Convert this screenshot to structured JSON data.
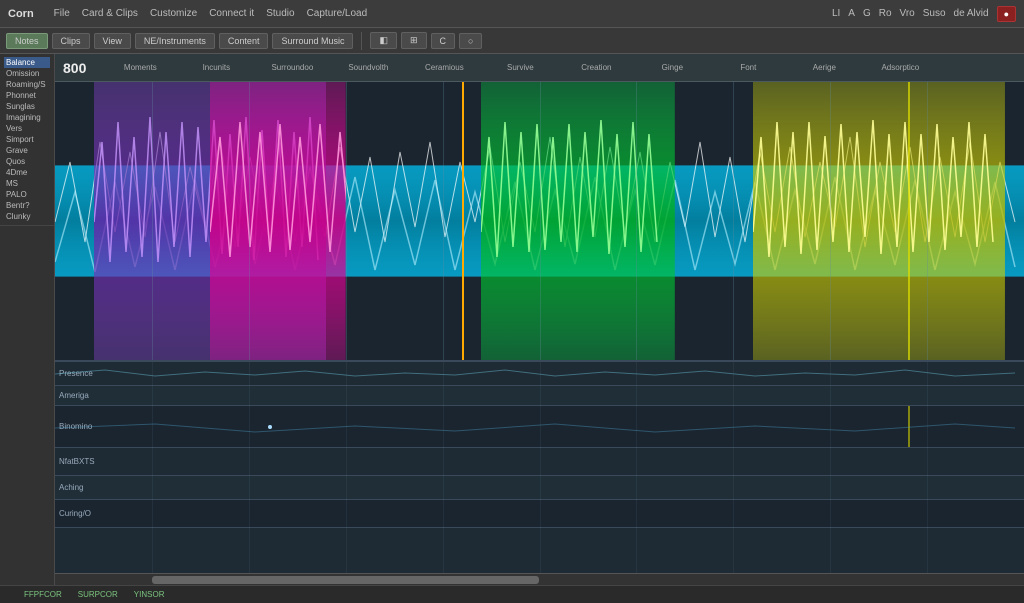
{
  "app": {
    "title": "Corn",
    "menu": [
      "File",
      "Card & Clips",
      "Customize",
      "Connect it",
      "Studio",
      "Capture/Load"
    ]
  },
  "right_controls": {
    "items": [
      "LI",
      "A",
      "G",
      "Ro",
      "Vro",
      "Suso",
      "de Alvid"
    ],
    "rec_label": "●"
  },
  "toolbar": {
    "buttons": [
      "Notes",
      "Clips",
      "View",
      "NE/Instruments",
      "Content",
      "Surround Music"
    ],
    "active_index": 0,
    "icon_buttons": [
      "◧",
      "⊞",
      "C",
      "○"
    ]
  },
  "sidebar": {
    "items": [
      "Balance",
      "Omission",
      "Roaming/S",
      "Phonnet",
      "Sunglas",
      "Imagining",
      "Vers",
      "Simport",
      "Grave",
      "Quos",
      "4Dme",
      "MS",
      "PALO",
      "Bentr?",
      "Clunky"
    ]
  },
  "track_header": {
    "time": "800",
    "columns": [
      "Moments",
      "Incunits",
      "Surroundoo",
      "Soundvolth",
      "Ceramious",
      "Survive",
      "Creation",
      "Ginge",
      "Font",
      "Aerige",
      "Adsorptico"
    ]
  },
  "waveform": {
    "segments": [
      {
        "color": "#cc44ff",
        "x_pct": 5,
        "w_pct": 22,
        "label": "purple"
      },
      {
        "color": "#ff00cc",
        "x_pct": 18,
        "w_pct": 12,
        "label": "magenta"
      },
      {
        "color": "#00ccff",
        "x_pct": 0,
        "w_pct": 100,
        "label": "cyan-base"
      },
      {
        "color": "#00dd44",
        "x_pct": 44,
        "w_pct": 20,
        "label": "green"
      },
      {
        "color": "#dddd00",
        "x_pct": 73,
        "w_pct": 24,
        "label": "yellow"
      }
    ],
    "playhead_pct": 42,
    "grid_lines_pct": [
      10,
      20,
      30,
      40,
      50,
      60,
      70,
      80,
      90
    ]
  },
  "lower_tracks": {
    "rows": [
      {
        "label": "Presence"
      },
      {
        "label": "Ameriga"
      },
      {
        "label": "Binomino"
      },
      {
        "label": "NfatBXTS"
      },
      {
        "label": "Aching"
      },
      {
        "label": "Curing/O"
      }
    ]
  },
  "status_bar": {
    "items": [
      "",
      "FFPFCOR",
      "SURPCOR",
      "YINSOR"
    ]
  }
}
